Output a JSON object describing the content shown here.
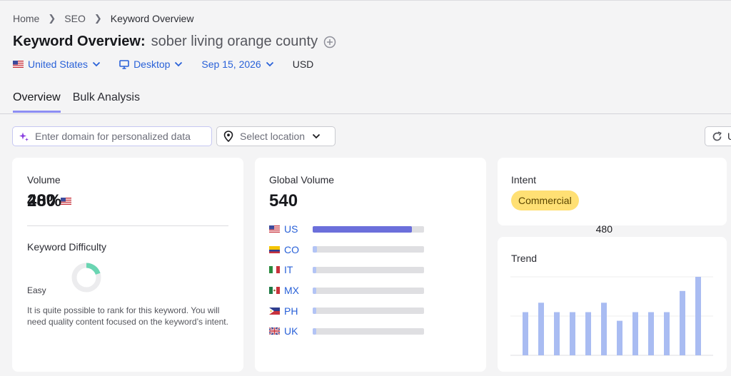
{
  "breadcrumb": {
    "home": "Home",
    "seo": "SEO",
    "current": "Keyword Overview"
  },
  "header": {
    "title": "Keyword Overview:",
    "keyword": "sober living orange county"
  },
  "filters": {
    "country": "United States",
    "device": "Desktop",
    "date": "Sep 15, 2026",
    "currency": "USD"
  },
  "tabs": [
    {
      "label": "Overview",
      "active": true
    },
    {
      "label": "Bulk Analysis",
      "active": false
    }
  ],
  "toolbar": {
    "domain_placeholder": "Enter domain for personalized data",
    "location_placeholder": "Select location",
    "refresh_label": "U"
  },
  "volume": {
    "label": "Volume",
    "value": "480"
  },
  "difficulty": {
    "label": "Keyword Difficulty",
    "value": "20%",
    "percent": 20,
    "level": "Easy",
    "description": "It is quite possible to rank for this keyword. You will need quality content focused on the keyword’s intent.",
    "color": "#6ad5b2"
  },
  "global_volume": {
    "label": "Global Volume",
    "value": "540",
    "countries": [
      {
        "code": "US",
        "value": "480",
        "share": 0.89,
        "fill": "#6b6fdb",
        "value_color": "#1b1b1f"
      },
      {
        "code": "CO",
        "value": "20",
        "share": 0.04,
        "fill": "#b3c4f5",
        "value_color": "#2961d8"
      },
      {
        "code": "IT",
        "value": "10",
        "share": 0.03,
        "fill": "#b3c4f5",
        "value_color": "#2961d8"
      },
      {
        "code": "MX",
        "value": "10",
        "share": 0.03,
        "fill": "#b3c4f5",
        "value_color": "#2961d8"
      },
      {
        "code": "PH",
        "value": "10",
        "share": 0.03,
        "fill": "#b3c4f5",
        "value_color": "#2961d8"
      },
      {
        "code": "UK",
        "value": "10",
        "share": 0.03,
        "fill": "#b3c4f5",
        "value_color": "#2961d8"
      }
    ]
  },
  "intent": {
    "label": "Intent",
    "value": "Commercial"
  },
  "trend": {
    "label": "Trend",
    "color": "#a9bcf2"
  },
  "chart_data": {
    "type": "bar",
    "title": "Trend",
    "values": [
      0.55,
      0.67,
      0.55,
      0.55,
      0.55,
      0.67,
      0.44,
      0.55,
      0.55,
      0.55,
      0.82,
      1.0
    ],
    "ylim": [
      0,
      1
    ],
    "grid": true
  }
}
